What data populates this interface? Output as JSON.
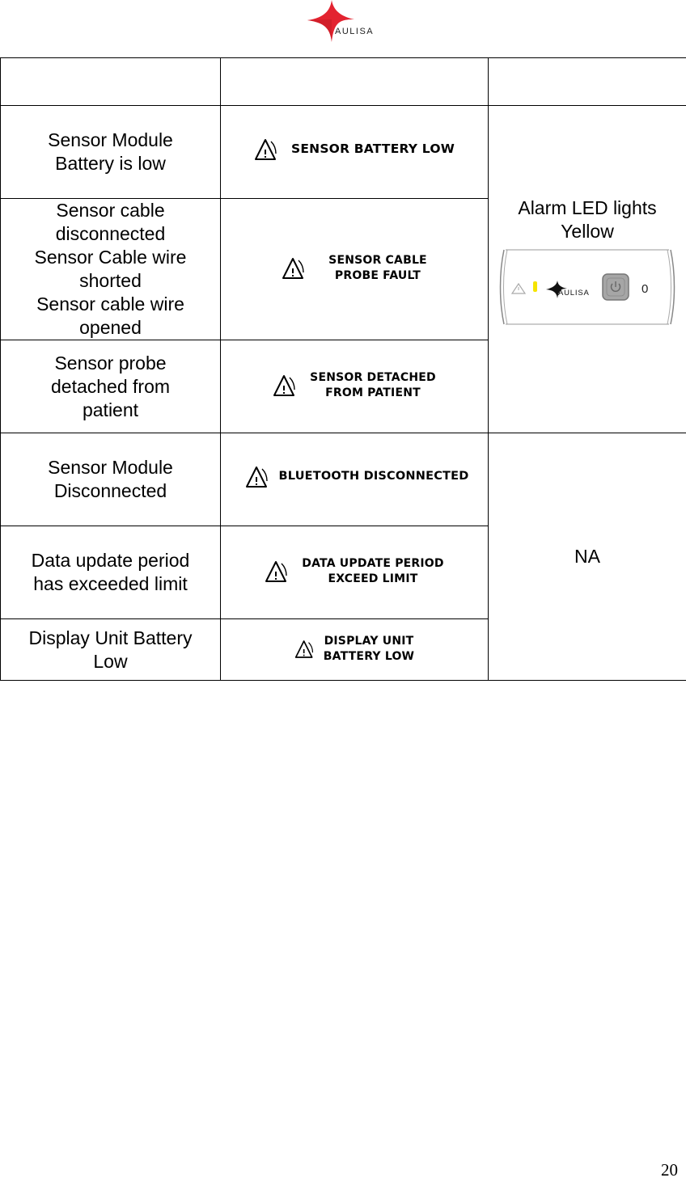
{
  "header": {
    "logo_text": "AULISA",
    "logo_colors": {
      "mark": "#e32330",
      "text": "#222222"
    }
  },
  "table": {
    "header_row": [
      "",
      "",
      ""
    ],
    "rows": [
      {
        "condition": "Sensor Module Battery is low",
        "message": [
          "SENSOR BATTERY LOW"
        ]
      },
      {
        "condition_lines": [
          "Sensor cable disconnected",
          "Sensor Cable wire shorted",
          "Sensor cable wire opened"
        ],
        "message": [
          "SENSOR CABLE",
          "PROBE FAULT"
        ]
      },
      {
        "condition": "Sensor probe detached from patient",
        "message": [
          "SENSOR DETACHED",
          "FROM PATIENT"
        ]
      },
      {
        "condition": "Sensor Module Disconnected",
        "message": [
          "BLUETOOTH DISCONNECTED"
        ]
      },
      {
        "condition": "Data update period has exceeded limit",
        "message": [
          "DATA UPDATE PERIOD",
          "EXCEED LIMIT"
        ]
      },
      {
        "condition": "Display Unit Battery Low",
        "message": [
          "DISPLAY UNIT",
          "BATTERY LOW"
        ]
      }
    ],
    "indicator_groups": [
      {
        "text": "Alarm LED lights Yellow",
        "device": {
          "logo_text": "AULISA",
          "led_color": "#f5e400",
          "counter_value": "0"
        }
      },
      {
        "text": "NA"
      }
    ]
  },
  "footer": {
    "page_number": "20"
  }
}
